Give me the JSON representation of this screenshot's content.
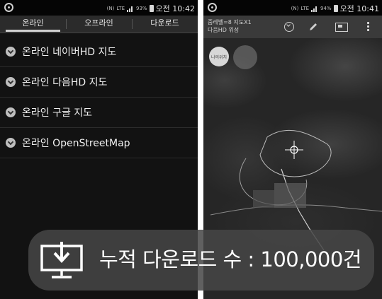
{
  "left_screen": {
    "status": {
      "clock": "오전 10:42",
      "battery": "93%",
      "network": "LTE"
    },
    "tabs": [
      {
        "label": "온라인",
        "active": true
      },
      {
        "label": "오프라인",
        "active": false
      },
      {
        "label": "다운로드",
        "active": false
      }
    ],
    "map_sources": [
      {
        "label": "온라인 네이버HD 지도"
      },
      {
        "label": "온라인 다음HD 지도"
      },
      {
        "label": "온라인 구글 지도"
      },
      {
        "label": "온라인 OpenStreetMap"
      }
    ]
  },
  "right_screen": {
    "status": {
      "clock": "오전 10:41",
      "battery": "94%",
      "network": "LTE"
    },
    "toolbar": {
      "caption_line1": "줌레벨=8 지도X1",
      "caption_line2": "다음HD 위성"
    },
    "compass_label": "나의위치"
  },
  "banner": {
    "text": "누적 다운로드 수 : 100,000건"
  },
  "colors": {
    "background": "#121212",
    "tab_bar": "#2b2b2b",
    "banner": "#464646"
  },
  "icons": [
    "app-icon",
    "signal-icon",
    "battery-icon",
    "chevron-down-icon",
    "pencil-icon",
    "layers-icon",
    "more-icon",
    "compass-icon",
    "download-icon"
  ]
}
